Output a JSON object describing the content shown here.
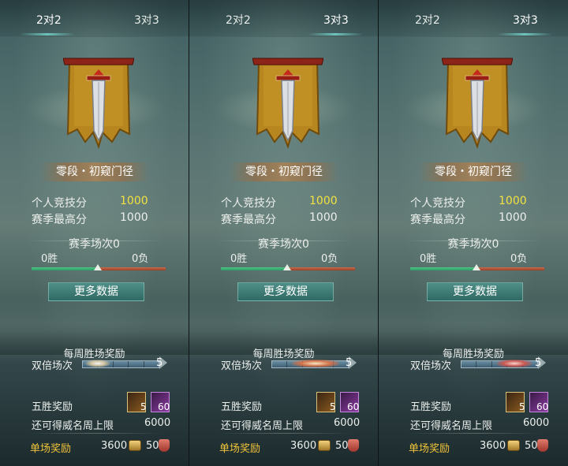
{
  "tabs": [
    "2对2",
    "3对3"
  ],
  "rank_title": "零段・初窥门径",
  "stats": {
    "personal_score_label": "个人竞技分",
    "personal_score_value": "1000",
    "season_high_label": "赛季最高分",
    "season_high_value": "1000"
  },
  "season": {
    "matches_label": "赛季场次0",
    "wins": "0胜",
    "losses": "0负",
    "win_fraction": 0.5
  },
  "more_data_button": "更多数据",
  "weekly": {
    "title": "每周胜场奖励",
    "double_label": "双倍场次",
    "double_count": "5"
  },
  "five_win": {
    "label": "五胜奖励",
    "items": [
      {
        "icon": "treasure-chest-icon",
        "count": "5"
      },
      {
        "icon": "purple-gem-icon",
        "count": "60"
      }
    ]
  },
  "fame_limit": {
    "label": "还可得威名周上限",
    "value": "6000"
  },
  "single_reward": {
    "label": "单场奖励",
    "coins": "3600",
    "shields": "50"
  },
  "colors": {
    "gold_text": "#f3e240",
    "reward_label": "#f0c43a",
    "win_bar": "#3fae78",
    "loss_bar": "#b3543a",
    "button": "#3f7e77"
  }
}
